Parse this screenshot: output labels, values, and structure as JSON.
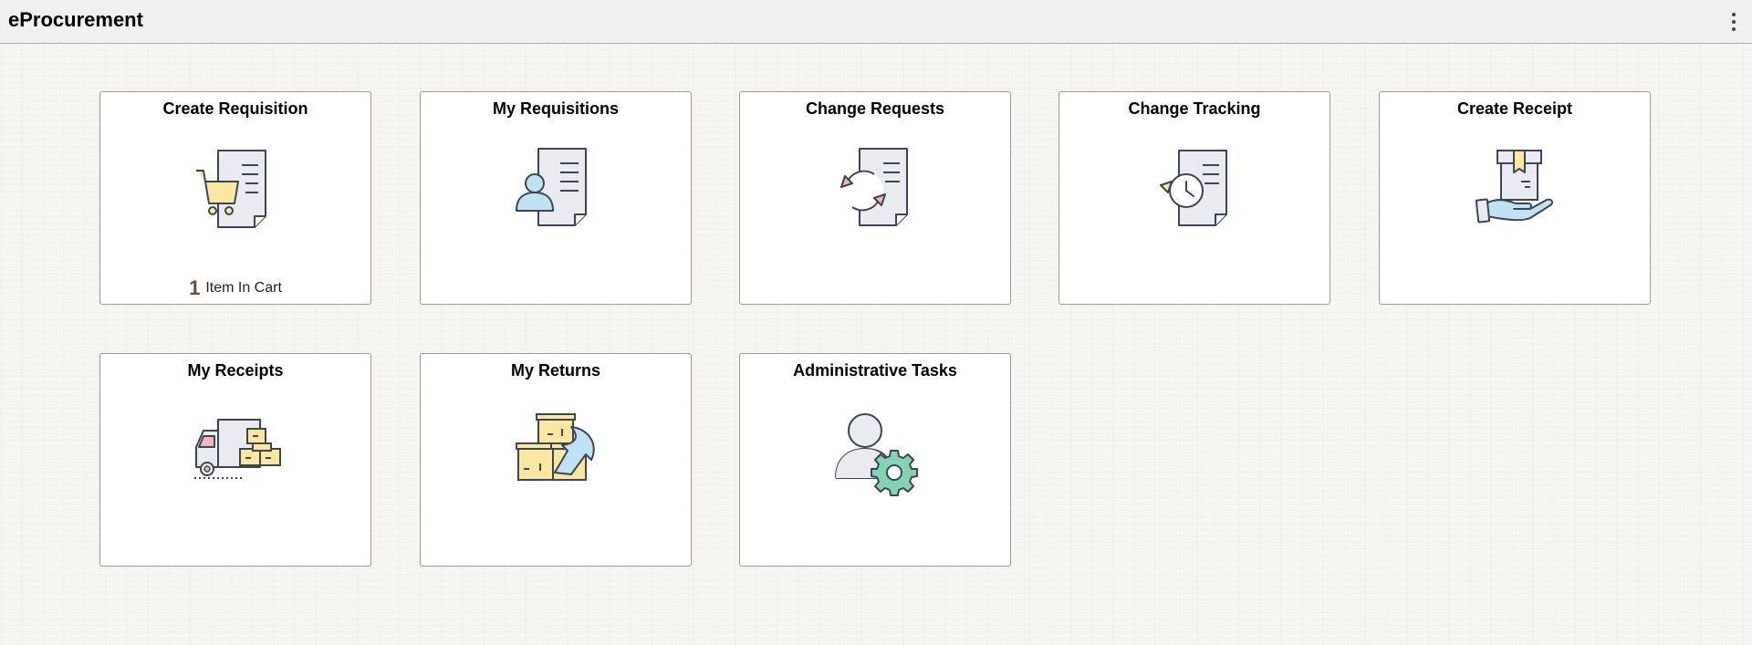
{
  "app": {
    "title": "eProcurement",
    "actions_menu_icon": "more-vertical-icon"
  },
  "tiles": [
    {
      "title": "Create Requisition",
      "icon": "shopping-cart-document-icon",
      "badge_count": "1",
      "badge_text": "Item In Cart"
    },
    {
      "title": "My Requisitions",
      "icon": "user-document-icon"
    },
    {
      "title": "Change Requests",
      "icon": "refresh-document-icon"
    },
    {
      "title": "Change Tracking",
      "icon": "history-document-icon"
    },
    {
      "title": "Create Receipt",
      "icon": "hand-holding-box-icon"
    },
    {
      "title": "My Receipts",
      "icon": "delivery-truck-boxes-icon"
    },
    {
      "title": "My Returns",
      "icon": "return-boxes-icon"
    },
    {
      "title": "Administrative Tasks",
      "icon": "user-gear-icon"
    }
  ],
  "colors": {
    "icon_stroke": "#3d4452",
    "page_fill": "#e9ebf1",
    "accent_yellow": "#fbe7a1",
    "accent_blue": "#bfe3f5",
    "accent_red": "#f0b5bf",
    "accent_green": "#84d3b2",
    "badge_count": "#6b4a2e"
  }
}
